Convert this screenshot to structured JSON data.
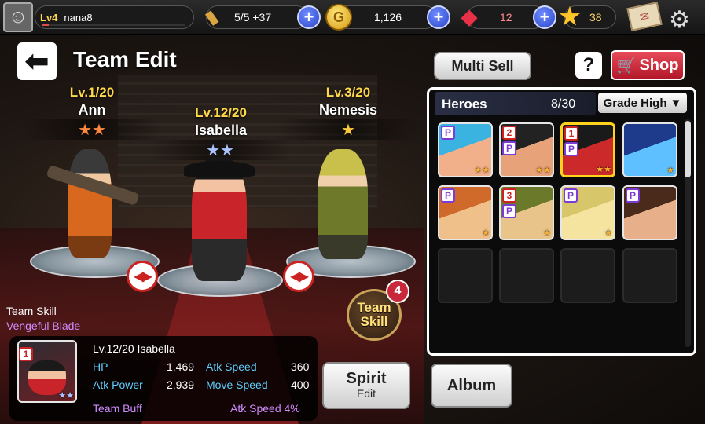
{
  "topbar": {
    "level": "Lv4",
    "username": "nana8",
    "xp_fraction": 0.05,
    "stamina": "5/5 +37",
    "gold": "1,126",
    "gems": "12",
    "stars": "38",
    "gold_icon_letter": "G"
  },
  "header": {
    "title": "Team Edit"
  },
  "stage": {
    "heroes": [
      {
        "level": "Lv.1/20",
        "name": "Ann",
        "stars": "★★",
        "star_color": "#ff8a3d"
      },
      {
        "level": "Lv.12/20",
        "name": "Isabella",
        "stars": "★★",
        "star_color": "#a9c4ff"
      },
      {
        "level": "Lv.3/20",
        "name": "Nemesis",
        "stars": "★",
        "star_color": "#ffc93d"
      }
    ]
  },
  "team_skill": {
    "label": "Team Skill",
    "name": "Vengeful Blade",
    "button_line1": "Team",
    "button_line2": "Skill",
    "badge": "4"
  },
  "info": {
    "badge": "1",
    "title": "Lv.12/20 Isabella",
    "hp_label": "HP",
    "hp": "1,469",
    "atk_speed_label": "Atk Speed",
    "atk_speed": "360",
    "atk_power_label": "Atk Power",
    "atk_power": "2,939",
    "move_speed_label": "Move Speed",
    "move_speed": "400",
    "team_buff_label": "Team Buff",
    "team_buff": "Atk Speed 4%"
  },
  "buttons": {
    "multi_sell": "Multi Sell",
    "help": "?",
    "shop": "Shop",
    "spirit": "Spirit",
    "spirit_sub": "Edit",
    "album": "Album"
  },
  "panel": {
    "title": "Heroes",
    "count": "8/30",
    "sort": "Grade High",
    "cards": [
      {
        "badge_p": "P",
        "badge_n": "",
        "stars": "★★",
        "colors": [
          "#3ab3e0",
          "#f2b08a"
        ]
      },
      {
        "badge_p": "P",
        "badge_n": "2",
        "stars": "★★",
        "colors": [
          "#222",
          "#e8a27a"
        ]
      },
      {
        "badge_p": "P",
        "badge_n": "1",
        "stars": "★★",
        "colors": [
          "#1a1a1a",
          "#cc2a2a"
        ],
        "selected": true
      },
      {
        "badge_p": "",
        "badge_n": "",
        "stars": "★",
        "colors": [
          "#1d3b8a",
          "#5fc0ff"
        ]
      },
      {
        "badge_p": "P",
        "badge_n": "",
        "stars": "★",
        "colors": [
          "#d06a2a",
          "#f0c08a"
        ]
      },
      {
        "badge_p": "P",
        "badge_n": "3",
        "stars": "★",
        "colors": [
          "#6b7a2a",
          "#e8c48a"
        ]
      },
      {
        "badge_p": "P",
        "badge_n": "",
        "stars": "★",
        "colors": [
          "#d8c66a",
          "#f5e3a0"
        ]
      },
      {
        "badge_p": "P",
        "badge_n": "",
        "stars": "",
        "colors": [
          "#4a2a1a",
          "#e8b08a"
        ]
      }
    ]
  }
}
